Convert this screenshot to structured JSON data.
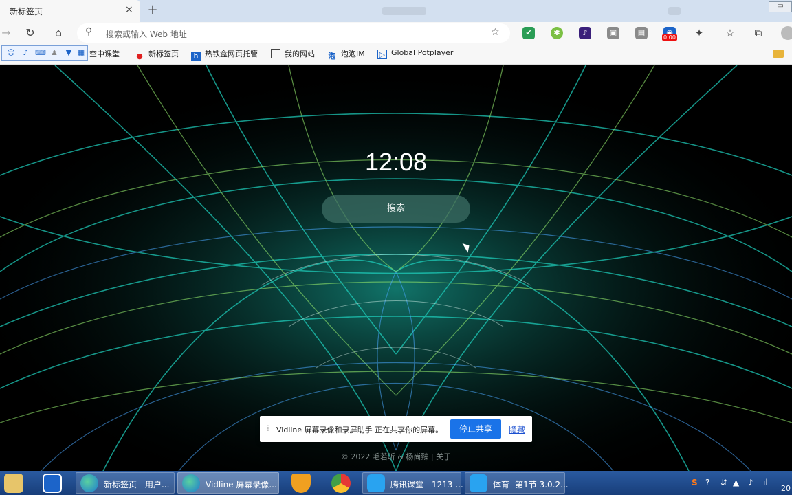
{
  "browser": {
    "tab_title": "新标签页",
    "tab_close": "×",
    "new_tab": "+",
    "address_placeholder": "搜索或输入 Web 地址",
    "ext_badge": "0:00"
  },
  "bookmarks": [
    {
      "label": "空中课堂",
      "icon": "bookmark-icon"
    },
    {
      "label": "新标签页",
      "icon": "baidu-icon"
    },
    {
      "label": "热铁盒网页托管",
      "icon": "site-icon"
    },
    {
      "label": "我的网站",
      "icon": "page-icon"
    },
    {
      "label": "泡泡IM",
      "icon": "paopao-icon"
    },
    {
      "label": "Global Potplayer",
      "icon": "potplayer-icon"
    }
  ],
  "newtab_page": {
    "clock": "12:08",
    "search_label": "搜索",
    "footer": "© 2022 毛若昕 & 杨尚臻 | 关于"
  },
  "share_bar": {
    "text": "Vidline 屏幕录像和录屏助手 正在共享你的屏幕。",
    "stop_label": "停止共享",
    "hide_label": "隐藏"
  },
  "taskbar": {
    "items": [
      {
        "label": "新标签页 - 用户...",
        "icon": "edge-icon"
      },
      {
        "label": "Vidline 屏幕录像...",
        "icon": "edge-icon"
      },
      {
        "label": "腾讯课堂 - 1213 ...",
        "icon": "tencent-classroom-icon"
      },
      {
        "label": "体育- 第1节 3.0.2...",
        "icon": "tencent-classroom-icon"
      }
    ],
    "clock_partial": "20"
  },
  "colors": {
    "accent": "#1a73e8",
    "taskbar": "#1f4c8c",
    "art_primary": "#1fd3c0",
    "art_secondary": "#8fe36a"
  }
}
